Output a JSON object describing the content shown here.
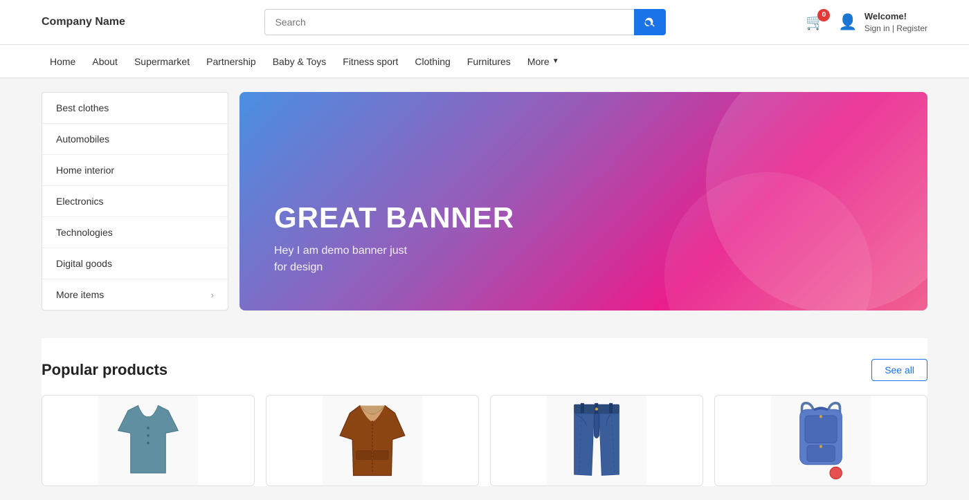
{
  "header": {
    "logo": "Company Name",
    "search": {
      "placeholder": "Search",
      "value": ""
    },
    "cart": {
      "badge": "0"
    },
    "user": {
      "welcome": "Welcome!",
      "signin_label": "Sign in | Register"
    }
  },
  "nav": {
    "items": [
      {
        "label": "Home",
        "id": "home"
      },
      {
        "label": "About",
        "id": "about"
      },
      {
        "label": "Supermarket",
        "id": "supermarket"
      },
      {
        "label": "Partnership",
        "id": "partnership"
      },
      {
        "label": "Baby &amp; Toys",
        "id": "baby-toys"
      },
      {
        "label": "Fitness sport",
        "id": "fitness"
      },
      {
        "label": "Clothing",
        "id": "clothing"
      },
      {
        "label": "Furnitures",
        "id": "furnitures"
      },
      {
        "label": "More",
        "id": "more",
        "has_arrow": true
      }
    ]
  },
  "sidebar": {
    "items": [
      {
        "label": "Best clothes",
        "id": "best-clothes",
        "has_arrow": false
      },
      {
        "label": "Automobiles",
        "id": "automobiles",
        "has_arrow": false
      },
      {
        "label": "Home interior",
        "id": "home-interior",
        "has_arrow": false
      },
      {
        "label": "Electronics",
        "id": "electronics",
        "has_arrow": false
      },
      {
        "label": "Technologies",
        "id": "technologies",
        "has_arrow": false
      },
      {
        "label": "Digital goods",
        "id": "digital-goods",
        "has_arrow": false
      },
      {
        "label": "More items",
        "id": "more-items",
        "has_arrow": true
      }
    ]
  },
  "banner": {
    "title": "GREAT BANNER",
    "subtitle": "Hey I am demo banner just\nfor design"
  },
  "popular": {
    "title": "Popular products",
    "see_all": "See all",
    "products": [
      {
        "id": "shirt",
        "type": "shirt"
      },
      {
        "id": "jacket",
        "type": "jacket"
      },
      {
        "id": "jeans",
        "type": "jeans"
      },
      {
        "id": "bag",
        "type": "bag"
      }
    ]
  }
}
